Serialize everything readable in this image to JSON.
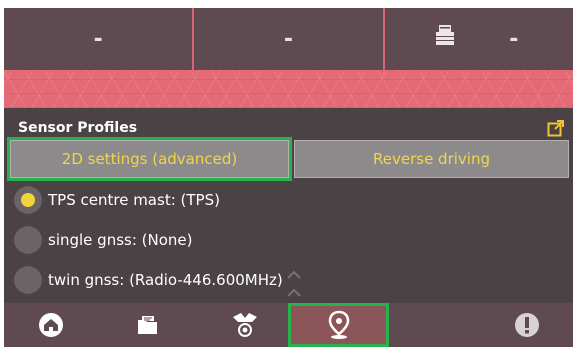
{
  "readouts": [
    {
      "value": "-"
    },
    {
      "value": "-"
    },
    {
      "value": "-",
      "icon": "printer-icon"
    }
  ],
  "section": {
    "title": "Sensor Profiles",
    "action_icon": "external-link-icon"
  },
  "tabs": [
    {
      "label": "2D settings (advanced)",
      "active": true
    },
    {
      "label": "Reverse driving",
      "active": false
    }
  ],
  "profiles": [
    {
      "label": "TPS centre mast: (TPS)",
      "selected": true
    },
    {
      "label": "single gnss: (None)",
      "selected": false
    },
    {
      "label": "twin gnss: (Radio-446.600MHz)",
      "selected": false
    }
  ],
  "bottom_nav": [
    {
      "icon": "home-icon"
    },
    {
      "icon": "folder-icon"
    },
    {
      "icon": "satellite-icon"
    },
    {
      "icon": "location-pin-icon",
      "active": true
    },
    {
      "icon": "info-icon"
    }
  ],
  "colors": {
    "accent_text": "#f0d64a",
    "highlight_outline": "#27b34b",
    "strip": "#e46b75",
    "background": "#4a4245"
  }
}
